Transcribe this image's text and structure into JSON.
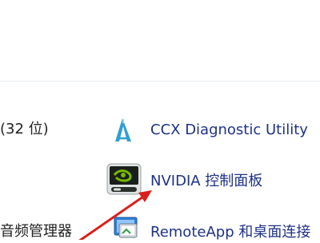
{
  "control_panel": {
    "left_items": [
      {
        "label": "(32 位)"
      },
      {
        "label": "音频管理器"
      }
    ],
    "right_items": [
      {
        "label": "CCX Diagnostic Utility",
        "icon": "ccx-icon"
      },
      {
        "label": "NVIDIA 控制面板",
        "icon": "nvidia-icon"
      },
      {
        "label": "RemoteApp 和桌面连接",
        "icon": "remoteapp-icon"
      }
    ]
  },
  "annotation": {
    "arrow_color": "#d9201a"
  }
}
